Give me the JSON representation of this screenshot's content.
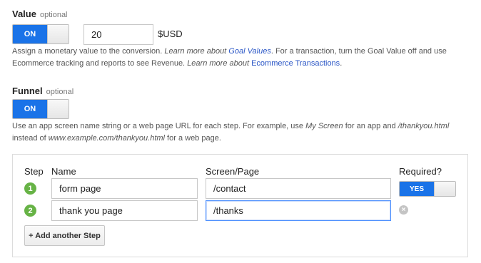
{
  "value": {
    "title": "Value",
    "optional": "optional",
    "toggle_label": "ON",
    "amount": "20",
    "currency": "$USD",
    "help": {
      "t1": "Assign a monetary value to the conversion. ",
      "t2": "Learn more about ",
      "link1": "Goal Values",
      "t3": ". For a transaction, turn the Goal Value off and use",
      "t4": "Ecommerce tracking and reports to see Revenue. ",
      "t5": "Learn more about ",
      "link2": "Ecommerce Transactions",
      "t6": "."
    }
  },
  "funnel": {
    "title": "Funnel",
    "optional": "optional",
    "toggle_label": "ON",
    "help": {
      "t1": "Use an app screen name string or a web page URL for each step. For example, use ",
      "i1": "My Screen",
      "t2": " for an app and ",
      "i2": "/thankyou.html",
      "t3": "instead of ",
      "i3": "www.example.com/thankyou.html",
      "t4": " for a web page."
    },
    "columns": {
      "step": "Step",
      "name": "Name",
      "screen": "Screen/Page",
      "required": "Required?"
    },
    "steps": [
      {
        "num": "1",
        "name": "form page",
        "page": "/contact",
        "required": "YES"
      },
      {
        "num": "2",
        "name": "thank you page",
        "page": "/thanks"
      }
    ],
    "add_step": "+ Add another Step"
  },
  "icons": {
    "remove": "remove-circle-icon"
  },
  "colors": {
    "accent": "#1a73e8",
    "step": "#67b346",
    "link": "#2a56c6"
  }
}
